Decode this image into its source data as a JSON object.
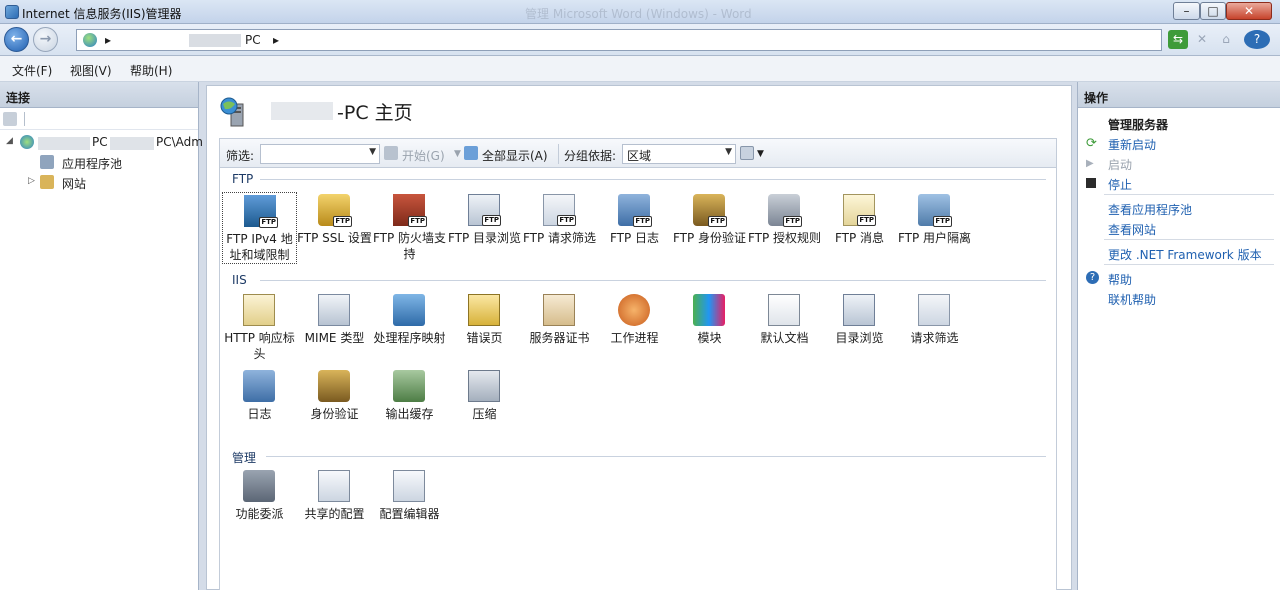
{
  "window": {
    "title": "Internet 信息服务(IIS)管理器",
    "ghost_title": "管理 Microsoft Word (Windows) - Word"
  },
  "address": {
    "segments": [
      "▸",
      "PC",
      "▸"
    ]
  },
  "menu": {
    "file": "文件(F)",
    "view": "视图(V)",
    "help": "帮助(H)"
  },
  "connections": {
    "header": "连接",
    "server_node_prefix": "PC",
    "server_node_suffix": "PC\\Adm",
    "app_pools": "应用程序池",
    "sites": "网站"
  },
  "main": {
    "title_suffix": "-PC 主页",
    "filter_label": "筛选:",
    "start_label": "开始(G)",
    "show_all_label": "全部显示(A)",
    "group_by_label": "分组依据:",
    "group_by_value": "区域"
  },
  "groups": {
    "ftp": {
      "title": "FTP",
      "items": [
        {
          "name": "ftp-ipv4",
          "label": "FTP IPv4 地址和域限制",
          "icon": "network-restrict-icon"
        },
        {
          "name": "ftp-ssl",
          "label": "FTP SSL 设置",
          "icon": "lock-icon"
        },
        {
          "name": "ftp-firewall",
          "label": "FTP 防火墙支持",
          "icon": "firewall-icon"
        },
        {
          "name": "ftp-dir-browse",
          "label": "FTP 目录浏览",
          "icon": "directory-browse-icon"
        },
        {
          "name": "ftp-request-filter",
          "label": "FTP 请求筛选",
          "icon": "filter-icon"
        },
        {
          "name": "ftp-log",
          "label": "FTP 日志",
          "icon": "log-icon"
        },
        {
          "name": "ftp-auth",
          "label": "FTP 身份验证",
          "icon": "auth-icon"
        },
        {
          "name": "ftp-authz",
          "label": "FTP 授权规则",
          "icon": "key-icon"
        },
        {
          "name": "ftp-messages",
          "label": "FTP 消息",
          "icon": "message-icon"
        },
        {
          "name": "ftp-user-isolation",
          "label": "FTP 用户隔离",
          "icon": "user-isolation-icon"
        }
      ]
    },
    "iis": {
      "title": "IIS",
      "items": [
        {
          "name": "http-headers",
          "label": "HTTP 响应标头",
          "icon": "http-headers-icon"
        },
        {
          "name": "mime-types",
          "label": "MIME 类型",
          "icon": "mime-icon"
        },
        {
          "name": "handler-mappings",
          "label": "处理程序映射",
          "icon": "handler-icon"
        },
        {
          "name": "error-pages",
          "label": "错误页",
          "icon": "error-404-icon"
        },
        {
          "name": "server-certs",
          "label": "服务器证书",
          "icon": "certificate-icon"
        },
        {
          "name": "worker-processes",
          "label": "工作进程",
          "icon": "worker-process-icon"
        },
        {
          "name": "modules",
          "label": "模块",
          "icon": "modules-icon"
        },
        {
          "name": "default-document",
          "label": "默认文档",
          "icon": "default-document-icon"
        },
        {
          "name": "dir-browsing",
          "label": "目录浏览",
          "icon": "directory-browse-icon"
        },
        {
          "name": "request-filtering",
          "label": "请求筛选",
          "icon": "filter-icon"
        },
        {
          "name": "logging",
          "label": "日志",
          "icon": "log-icon"
        },
        {
          "name": "authentication",
          "label": "身份验证",
          "icon": "auth-icon"
        },
        {
          "name": "output-caching",
          "label": "输出缓存",
          "icon": "cache-icon"
        },
        {
          "name": "compression",
          "label": "压缩",
          "icon": "compression-icon"
        }
      ]
    },
    "management": {
      "title": "管理",
      "items": [
        {
          "name": "feature-delegation",
          "label": "功能委派",
          "icon": "delegation-icon"
        },
        {
          "name": "shared-config",
          "label": "共享的配置",
          "icon": "shared-config-icon"
        },
        {
          "name": "config-editor",
          "label": "配置编辑器",
          "icon": "config-editor-icon"
        }
      ]
    }
  },
  "actions": {
    "header": "操作",
    "manage_server": "管理服务器",
    "restart": "重新启动",
    "start": "启动",
    "stop": "停止",
    "view_app_pools": "查看应用程序池",
    "view_sites": "查看网站",
    "change_net": "更改 .NET Framework 版本",
    "help": "帮助",
    "online_help": "联机帮助"
  },
  "colors": {
    "link": "#1f60b0",
    "group_header": "#1e3b66",
    "title_bar": "#c3d3ea"
  }
}
